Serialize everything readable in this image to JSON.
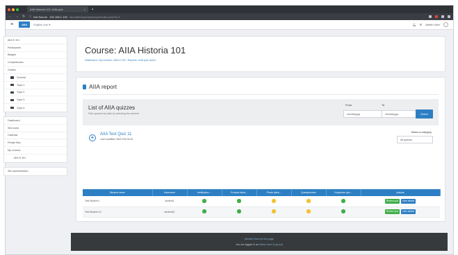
{
  "browser": {
    "tab_title": "AIIA Historia 101: AIIA quiz",
    "secure_label": "Not Secure",
    "url_host": "192.168.1.100",
    "url_path": "/moodle/report/quizreport/index.php?id=2",
    "colors": {
      "traffic": [
        "#ff5f57",
        "#febc2e",
        "#28c840"
      ]
    }
  },
  "navbar": {
    "brand": "AIIA",
    "language": "English (en) ▾",
    "user": "Admin User"
  },
  "drawer": {
    "course_items": [
      {
        "label": "AIIA H 101",
        "level": 0
      },
      {
        "label": "Participants",
        "level": 0
      },
      {
        "label": "Badges",
        "level": 0
      },
      {
        "label": "Competencies",
        "level": 0
      },
      {
        "label": "Grades",
        "level": 0
      },
      {
        "label": "General",
        "level": 1,
        "icon": "folder-icon"
      },
      {
        "label": "Topic 1",
        "level": 1,
        "icon": "folder-icon"
      },
      {
        "label": "Topic 2",
        "level": 1,
        "icon": "folder-icon"
      },
      {
        "label": "Topic 3",
        "level": 1,
        "icon": "folder-icon"
      },
      {
        "label": "Topic 4",
        "level": 1,
        "icon": "folder-icon"
      }
    ],
    "site_items": [
      {
        "label": "Dashboard",
        "level": 0
      },
      {
        "label": "Site home",
        "level": 0
      },
      {
        "label": "Calendar",
        "level": 0
      },
      {
        "label": "Private files",
        "level": 0
      },
      {
        "label": "My courses",
        "level": 0
      },
      {
        "label": "AIIA H 101",
        "level": 2
      }
    ],
    "admin_items": [
      {
        "label": "Site administration",
        "level": 0
      }
    ]
  },
  "header": {
    "title": "Course: AIIA Historia 101",
    "breadcrumb": "Dashboard / My courses / AIIA H 101 / Reports / AIIA quiz report"
  },
  "report": {
    "title": "AIIA report",
    "list_title": "List of AIIA quizzes",
    "list_subtitle": "Filter quizzes by date by selecting the desired",
    "from_label": "From",
    "to_label": "To",
    "from_placeholder": "mm/dd/yyyy",
    "to_placeholder": "mm/dd/yyyy",
    "select_button": "Select",
    "quiz_name": "AIIA Test Quiz 11",
    "quiz_date": "Last modified: 06/27/18 09:43",
    "category_label": "Select a category",
    "category_value": "All quizzes"
  },
  "table": {
    "headers": [
      "Student name",
      "Username",
      "Verification ...",
      "Product Ident...",
      "Photo Ident...",
      "Questionnaire",
      "Keystroke dyn...",
      "Actions"
    ],
    "rows": [
      {
        "name": "Test Student 1",
        "username": "student1",
        "status": [
          "green",
          "green",
          "yellow",
          "yellow",
          "green"
        ]
      },
      {
        "name": "Test Student 10",
        "username": "student10",
        "status": [
          "green",
          "green",
          "yellow",
          "yellow",
          "green"
        ]
      }
    ],
    "action_view": "Review quiz",
    "action_details": "User details",
    "colors": {
      "green": "#3fae49",
      "yellow": "#f2c230",
      "header": "#2d7fc4"
    }
  },
  "footer": {
    "docs_link": "Moodle Docs for this page",
    "logged_prefix": "You are logged in as",
    "logged_user": "Admin User (Log out)"
  }
}
